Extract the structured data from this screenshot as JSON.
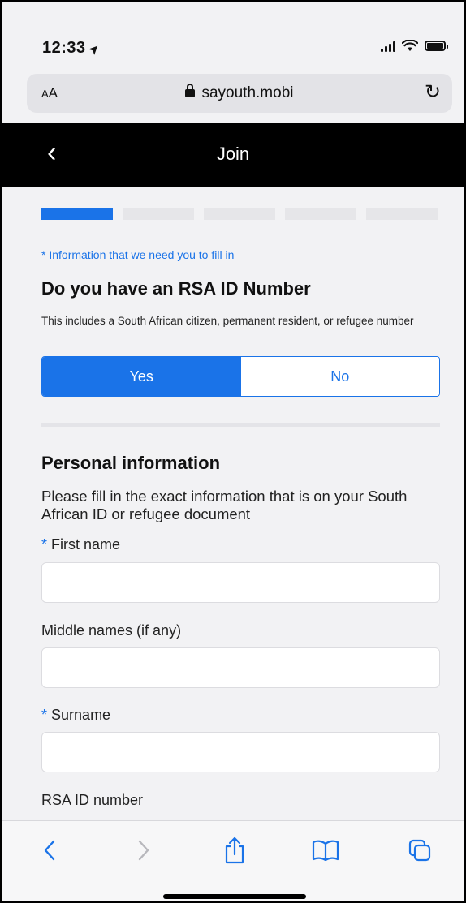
{
  "status_bar": {
    "time": "12:33",
    "location_arrow": "➤"
  },
  "browser": {
    "text_size_label_small": "A",
    "text_size_label_large": "A",
    "domain": "sayouth.mobi",
    "reload_glyph": "↻"
  },
  "header": {
    "back_glyph": "‹",
    "title": "Join"
  },
  "progress": {
    "total_steps": 5,
    "current_step": 1
  },
  "form": {
    "required_note": "* Information that we need you to fill in",
    "id_question": {
      "title": "Do you have an RSA ID Number",
      "subtitle": "This includes a South African citizen, permanent resident, or refugee number",
      "options": [
        "Yes",
        "No"
      ],
      "selected": "Yes"
    },
    "personal_info": {
      "title": "Personal information",
      "description": "Please fill in the exact information that is on your South African ID or refugee document"
    },
    "fields": {
      "first_name": {
        "required_mark": "*",
        "label": "First name",
        "value": ""
      },
      "middle_names": {
        "label": "Middle names (if any)",
        "value": ""
      },
      "surname": {
        "required_mark": "*",
        "label": "Surname",
        "value": ""
      },
      "rsa_id": {
        "label": "RSA ID number"
      }
    }
  },
  "colors": {
    "accent": "#1a73e8",
    "header_bg": "#000000",
    "page_bg": "#f2f2f4"
  },
  "toolbar": {
    "icons": [
      "back-icon",
      "forward-icon",
      "share-icon",
      "bookmarks-icon",
      "tabs-icon"
    ]
  }
}
